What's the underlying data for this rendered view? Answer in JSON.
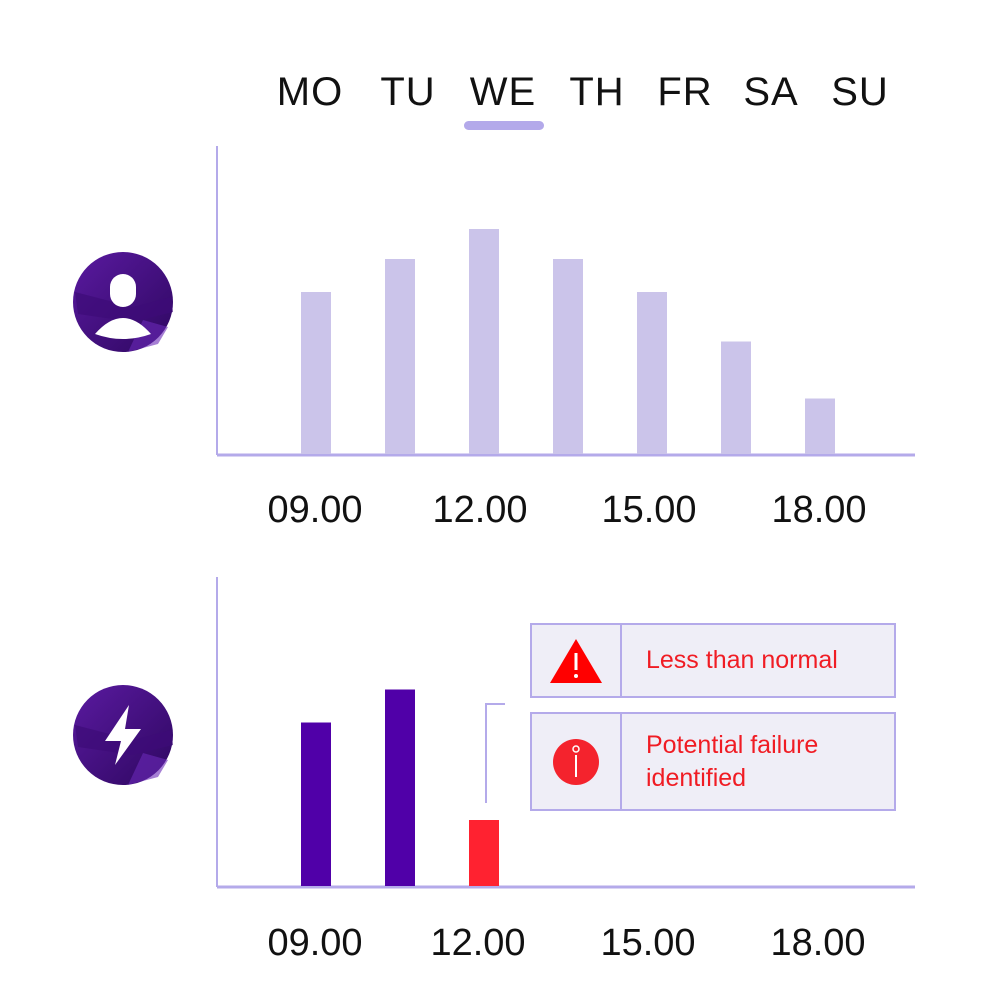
{
  "colors": {
    "axis": "#b4aaea",
    "bar_light": "#cbc4ea",
    "bar_dark": "#5000a8",
    "bar_alert": "#ff2230",
    "alert_text": "#f01c24",
    "alert_bg": "#efeef7",
    "day_underline": "#b3a9ea",
    "avatar_bg": "#4a0e86"
  },
  "days": {
    "items": [
      "MO",
      "TU",
      "WE",
      "TH",
      "FR",
      "SA",
      "SU"
    ],
    "selected": "WE"
  },
  "icons": {
    "chart1": "user-avatar-icon",
    "chart2": "lightning-bolt-icon",
    "alert1": "warning-triangle-icon",
    "alert2": "info-circle-icon"
  },
  "alerts": [
    {
      "icon": "warning-triangle-icon",
      "text": "Less than normal"
    },
    {
      "icon": "info-circle-icon",
      "text": "Potential failure identified",
      "lines": [
        "Potential failure",
        "identified"
      ]
    }
  ],
  "chart_data": [
    {
      "type": "bar",
      "title": "",
      "xlabel": "",
      "ylabel": "",
      "x_tick_labels": [
        "09.00",
        "12.00",
        "15.00",
        "18.00"
      ],
      "categories": [
        "09.00",
        "10.30",
        "12.00",
        "13.30",
        "15.00",
        "16.30",
        "18.00"
      ],
      "values": [
        5.4,
        6.5,
        7.5,
        6.5,
        5.4,
        3.75,
        1.85
      ],
      "ylim": [
        0,
        10
      ],
      "grid": false,
      "legend": "none",
      "series_color": "#cbc4ea"
    },
    {
      "type": "bar",
      "title": "",
      "xlabel": "",
      "ylabel": "",
      "x_tick_labels": [
        "09.00",
        "12.00",
        "15.00",
        "18.00"
      ],
      "categories": [
        "09.00",
        "10.30",
        "12.00"
      ],
      "values": [
        5.45,
        6.55,
        2.2
      ],
      "bar_colors": [
        "#5000a8",
        "#5000a8",
        "#ff2230"
      ],
      "ylim": [
        0,
        10
      ],
      "grid": false,
      "legend": "none",
      "annotations": [
        "Less than normal",
        "Potential failure identified"
      ]
    }
  ]
}
